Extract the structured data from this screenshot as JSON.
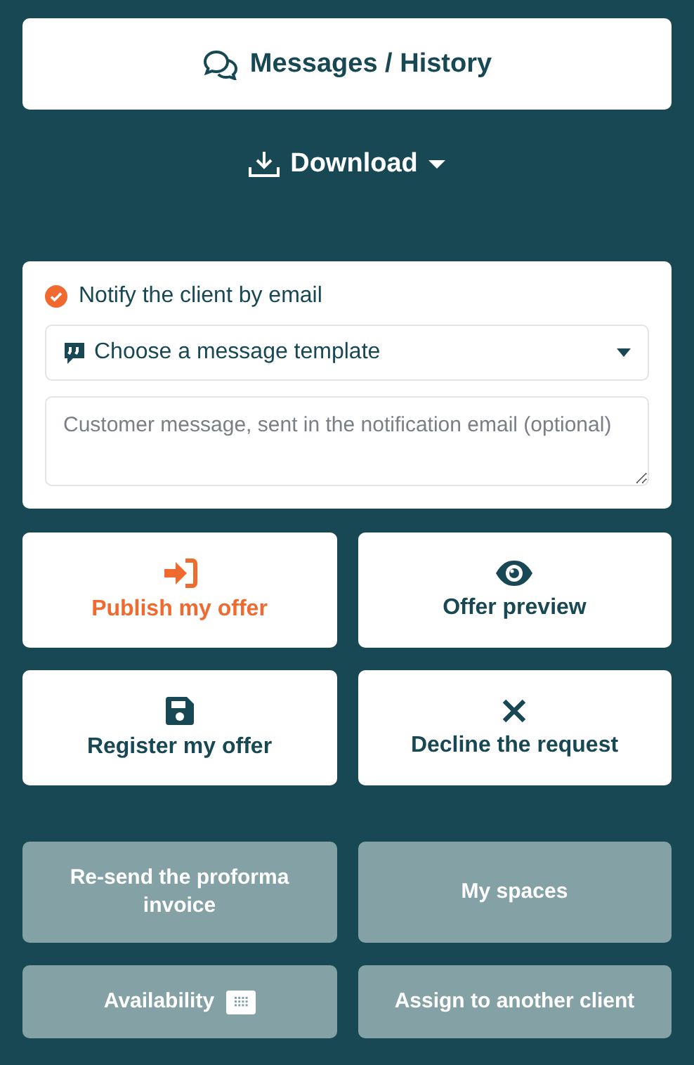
{
  "messages_button": {
    "label": "Messages / History"
  },
  "download_menu": {
    "label": "Download"
  },
  "notify": {
    "label": "Notify the client by email",
    "checked": true
  },
  "template_select": {
    "value": "Choose a message template"
  },
  "message_field": {
    "placeholder": "Customer message, sent in the notification email (optional)"
  },
  "actions": [
    {
      "label": "Publish my offer",
      "kind": "accent"
    },
    {
      "label": "Offer preview",
      "kind": "plain"
    },
    {
      "label": "Register my offer",
      "kind": "plain"
    },
    {
      "label": "Decline the request",
      "kind": "plain"
    }
  ],
  "secondary_actions": [
    {
      "label": "Re-send the proforma invoice"
    },
    {
      "label": "My spaces"
    },
    {
      "label": "Availability"
    },
    {
      "label": "Assign to another client"
    }
  ]
}
